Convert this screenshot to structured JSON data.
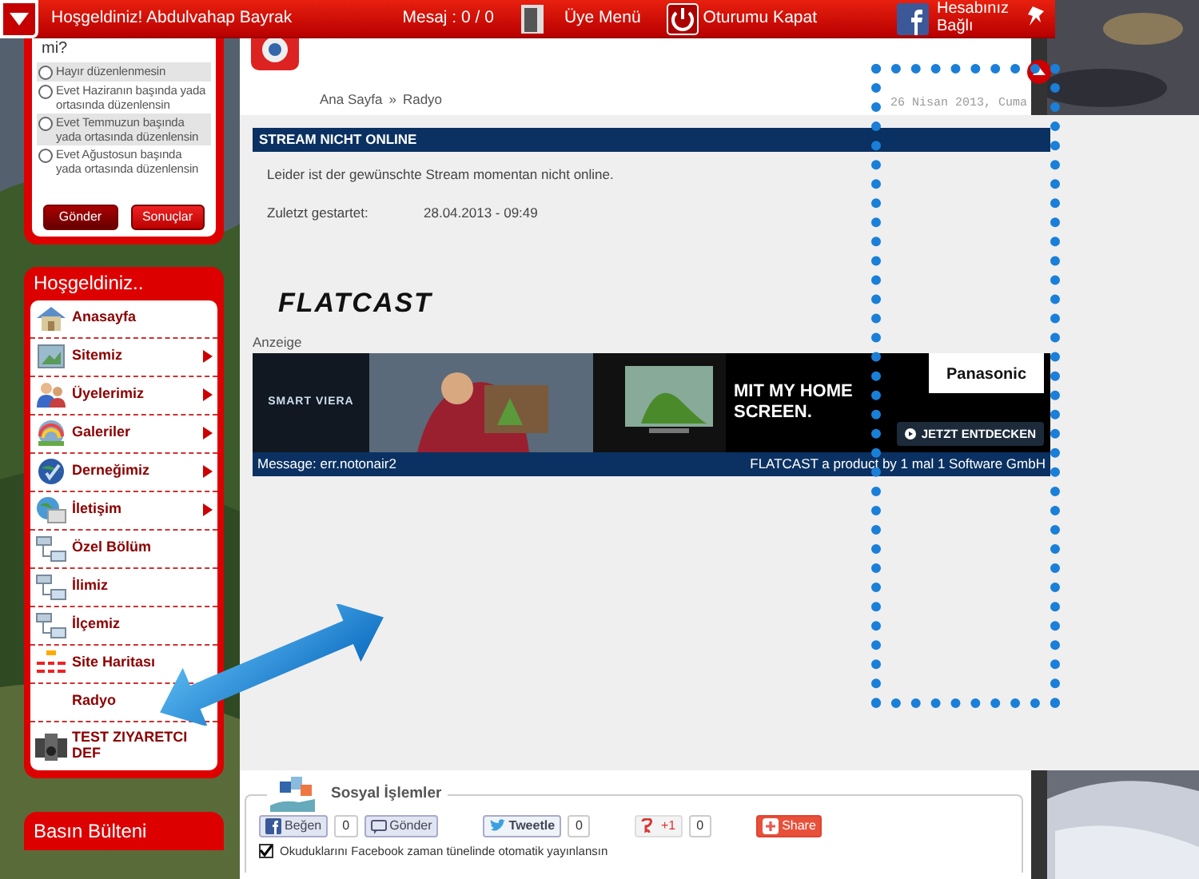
{
  "topbar": {
    "welcome": "Hoşgeldiniz! Abdulvahap Bayrak",
    "messages": "Mesaj : 0 / 0",
    "member_menu": "Üye Menü",
    "logout": "Oturumu Kapat",
    "facebook": "Hesabınız Bağlı"
  },
  "poll": {
    "question_tail": "mi?",
    "options": [
      {
        "label": "Hayır düzenlenmesin",
        "selected": false
      },
      {
        "label": "Evet Haziranın başında yada ortasında düzenlensin",
        "selected": false
      },
      {
        "label": "Evet Temmuzun başında yada ortasında düzenlensin",
        "selected": false
      },
      {
        "label": "Evet Ağustosun başında yada ortasında düzenlensin",
        "selected": false
      }
    ],
    "buttons": [
      "Gönder",
      "Sonuçlar"
    ]
  },
  "menu": {
    "title": "Hoşgeldiniz..",
    "items": [
      {
        "label": "Anasayfa",
        "has_submenu": false
      },
      {
        "label": "Sitemiz",
        "has_submenu": true
      },
      {
        "label": "Üyelerimiz",
        "has_submenu": true
      },
      {
        "label": "Galeriler",
        "has_submenu": true
      },
      {
        "label": "Derneğimiz",
        "has_submenu": true
      },
      {
        "label": "İletişim",
        "has_submenu": true
      },
      {
        "label": "Özel Bölüm",
        "has_submenu": false
      },
      {
        "label": "İlimiz",
        "has_submenu": false
      },
      {
        "label": "İlçemiz",
        "has_submenu": false
      },
      {
        "label": "Site Haritası",
        "has_submenu": false
      },
      {
        "label": "Radyo",
        "has_submenu": false
      },
      {
        "label": "TEST ZIYARETCI DEF",
        "has_submenu": false
      }
    ]
  },
  "press": {
    "title": "Basın Bülteni"
  },
  "breadcrumb": {
    "items": [
      "Ana Sayfa",
      "Radyo"
    ],
    "separator": "»"
  },
  "date": "26 Nisan 2013, Cuma",
  "stream": {
    "title": "STREAM NICHT ONLINE",
    "message": "Leider ist der gewünschte Stream momentan nicht online.",
    "last_started_label": "Zuletzt gestartet:",
    "last_started_value": "28.04.2013 - 09:49",
    "logo": "FLATCAST",
    "ad_label": "Anzeige",
    "ad": {
      "brand_logo": "SMART VIERA",
      "headline": "MIT MY HOME SCREEN.",
      "maker": "Panasonic",
      "cta": "JETZT ENTDECKEN"
    },
    "footer_left": "Message: err.notonair2",
    "footer_right": "FLATCAST a product by 1 mal 1 Software GmbH"
  },
  "social": {
    "title": "Sosyal İşlemler",
    "buttons": [
      {
        "kind": "facebook",
        "label": "Beğen",
        "count": "0"
      },
      {
        "kind": "send",
        "label": "Gönder"
      },
      {
        "kind": "twitter",
        "label": "Tweetle",
        "count": "0"
      },
      {
        "kind": "gplus",
        "label": "+1",
        "count": "0"
      },
      {
        "kind": "share",
        "label": "Share"
      }
    ],
    "auto_publish": {
      "label": "Okuduklarını Facebook zaman tünelinde otomatik yayınlansın",
      "checked": true
    }
  }
}
